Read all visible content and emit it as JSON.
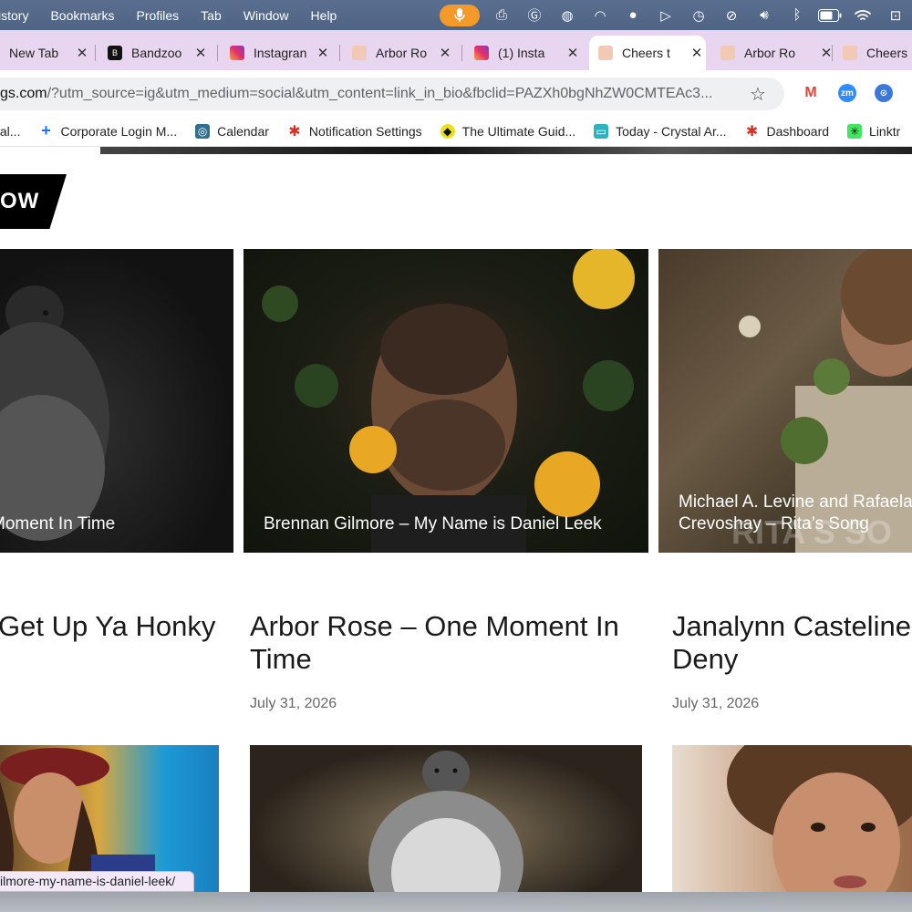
{
  "menubar": {
    "items": [
      "istory",
      "Bookmarks",
      "Profiles",
      "Tab",
      "Window",
      "Help"
    ],
    "status_icons": [
      "microphone-icon",
      "printer-icon",
      "grammarly-icon",
      "password-icon",
      "vpn-icon",
      "user-icon",
      "play-icon",
      "time-machine-icon",
      "wireless-off-icon",
      "volume-icon",
      "bluetooth-icon",
      "battery-icon",
      "wifi-icon",
      "screen-icon"
    ]
  },
  "tabs": [
    {
      "title": "New Tab",
      "favicon": "none",
      "active": false
    },
    {
      "title": "Bandzoo",
      "favicon": "bandzoogle-icon",
      "active": false
    },
    {
      "title": "Instagran",
      "favicon": "instagram-icon",
      "active": false
    },
    {
      "title": "Arbor Ro",
      "favicon": "site-icon",
      "active": false
    },
    {
      "title": "(1) Insta",
      "favicon": "instagram-icon",
      "active": false
    },
    {
      "title": "Cheers t",
      "favicon": "site-icon",
      "active": true
    },
    {
      "title": "Arbor Ro",
      "favicon": "site-icon",
      "active": false
    },
    {
      "title": "Cheers",
      "favicon": "site-icon",
      "active": false
    }
  ],
  "address": {
    "host": "gs.com",
    "rest": "/?utm_source=ig&utm_medium=social&utm_content=link_in_bio&fbclid=PAZXh0bgNhZW0CMTEAc3..."
  },
  "extensions": [
    {
      "name": "gmail-icon",
      "label": "M",
      "color": "#ea4335"
    },
    {
      "name": "zoom-icon",
      "label": "zm",
      "color": "#2d8cff"
    },
    {
      "name": "extension-icon",
      "label": "⊙",
      "color": "#3c78d8"
    }
  ],
  "bookmarks": [
    {
      "label": "tal...",
      "icon": ""
    },
    {
      "label": "Corporate Login M...",
      "icon": "+"
    },
    {
      "label": "Calendar",
      "icon": "◎"
    },
    {
      "label": "Notification Settings",
      "icon": "✱"
    },
    {
      "label": "The Ultimate Guid...",
      "icon": "◆"
    },
    {
      "label": "Today - Crystal Ar...",
      "icon": "▭"
    },
    {
      "label": "Dashboard",
      "icon": "✱"
    },
    {
      "label": "Linktr",
      "icon": "✳"
    }
  ],
  "section_label": "OW",
  "cards": [
    {
      "caption": "Moment In Time"
    },
    {
      "caption": "Brennan Gilmore – My Name is Daniel Leek"
    },
    {
      "caption_line1": "Michael A. Levine and Rafaela",
      "caption_line2": "Crevoshay – Rita’s Song",
      "overlay_text": "RITA'S SO"
    }
  ],
  "posts": [
    {
      "title_line1": "Get Up Ya Honky",
      "title_line2": "",
      "date": ""
    },
    {
      "title_line1": "Arbor Rose – One Moment In",
      "title_line2": "Time",
      "date": "July 31, 2026"
    },
    {
      "title_line1": "Janalynn Casteline",
      "title_line2": "Deny",
      "date": "July 31, 2026"
    }
  ],
  "status_url": "ilmore-my-name-is-daniel-leek/"
}
